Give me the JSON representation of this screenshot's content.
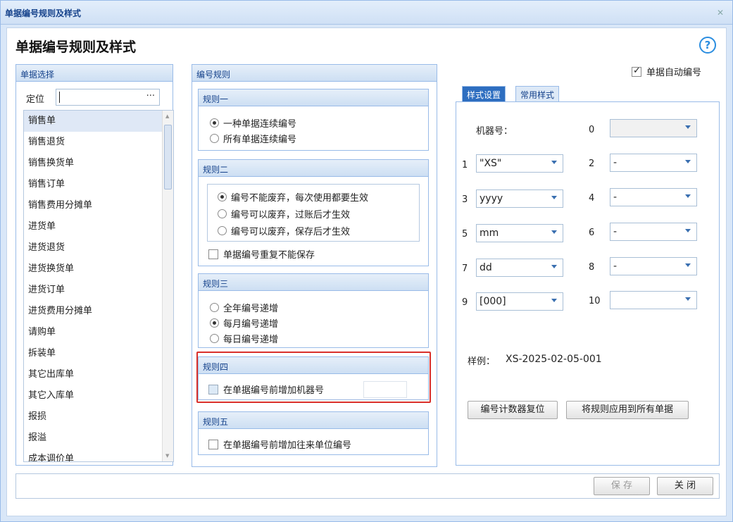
{
  "window": {
    "title": "单据编号规则及样式",
    "close": "✕"
  },
  "header": {
    "title": "单据编号规则及样式",
    "help": "?"
  },
  "left": {
    "title": "单据选择",
    "locate_label": "定位",
    "locate_button": "···",
    "items": [
      "销售单",
      "销售退货",
      "销售换货单",
      "销售订单",
      "销售费用分摊单",
      "进货单",
      "进货退货",
      "进货换货单",
      "进货订单",
      "进货费用分摊单",
      "请购单",
      "拆装单",
      "其它出库单",
      "其它入库单",
      "报损",
      "报溢",
      "成本调价单"
    ]
  },
  "rules": {
    "title": "编号规则",
    "r1": {
      "title": "规则一",
      "opt1": "一种单据连续编号",
      "opt2": "所有单据连续编号"
    },
    "r2": {
      "title": "规则二",
      "opt1": "编号不能废弃，每次使用都要生效",
      "opt2": "编号可以废弃，过账后才生效",
      "opt3": "编号可以废弃，保存后才生效",
      "check": "单据编号重复不能保存"
    },
    "r3": {
      "title": "规则三",
      "opt1": "全年编号递增",
      "opt2": "每月编号递增",
      "opt3": "每日编号递增"
    },
    "r4": {
      "title": "规则四",
      "check": "在单据编号前增加机器号"
    },
    "r5": {
      "title": "规则五",
      "check": "在单据编号前增加往来单位编号"
    }
  },
  "right": {
    "auto_label": "单据自动编号",
    "tab1": "样式设置",
    "tab2": "常用样式",
    "machine_label": "机器号：",
    "n0": "0",
    "n1": "1",
    "n2": "2",
    "n3": "3",
    "n4": "4",
    "n5": "5",
    "n6": "6",
    "n7": "7",
    "n8": "8",
    "n9": "9",
    "n10": "10",
    "v1": "\"XS\"",
    "v2": "-",
    "v3": "yyyy",
    "v4": "-",
    "v5": "mm",
    "v6": "-",
    "v7": "dd",
    "v8": "-",
    "v9": "[000]",
    "sample_label": "样例：",
    "sample_value": "XS-2025-02-05-001",
    "btn_reset": "编号计数器复位",
    "btn_apply": "将规则应用到所有单据"
  },
  "footer": {
    "save": "保 存",
    "close": "关 闭"
  }
}
